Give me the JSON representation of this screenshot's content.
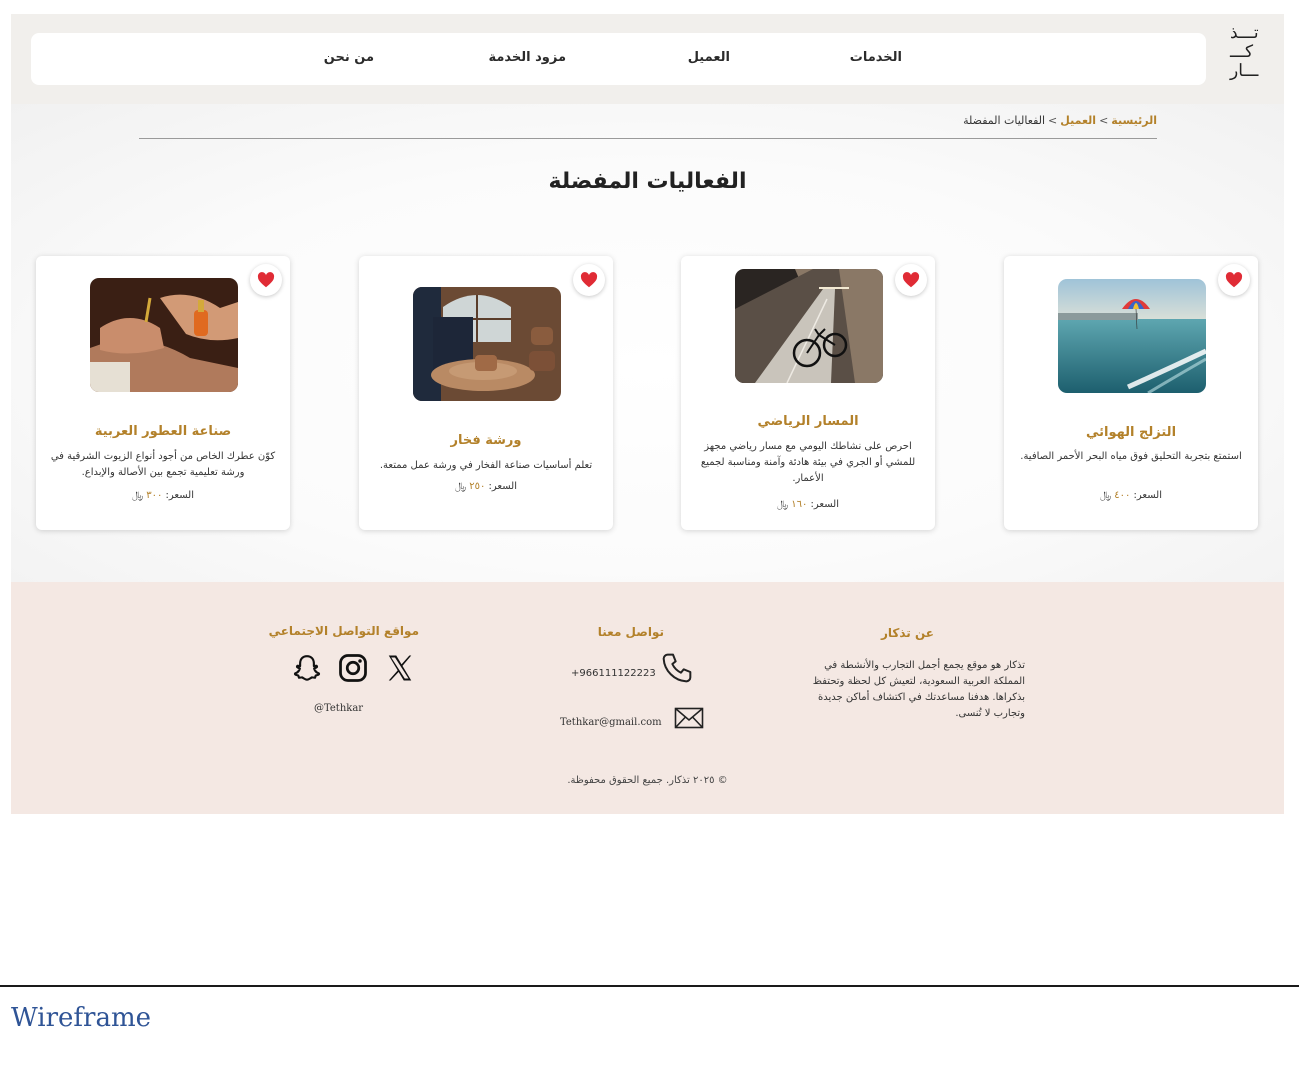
{
  "brand": {
    "logo_lines": [
      "تـــذ",
      "كـــ",
      "ـــار"
    ]
  },
  "nav": {
    "services": "الخدمات",
    "client": "العميل",
    "provider": "مزود الخدمة",
    "about": "من نحن"
  },
  "breadcrumb": {
    "home": "الرئيسية",
    "client": "العميل",
    "current": "الفعاليات المفضلة",
    "separator": ">"
  },
  "page": {
    "title": "الفعاليات المفضلة"
  },
  "cards": [
    {
      "title": "التزلج الهوائي",
      "description": "استمتع بتجربة التحليق فوق مياه البحر الأحمر الصافية.",
      "price_label": "السعر:",
      "price": "٤٠٠",
      "currency": "﷼",
      "image": "parasailing-photo",
      "favorite": true
    },
    {
      "title": "المسار الرياضي",
      "description": "احرص على نشاطك اليومي مع مسار رياضي مجهز للمشي أو الجري في بيئة هادئة وآمنة ومناسبة لجميع الأعمار.",
      "price_label": "السعر:",
      "price": "١٦٠",
      "currency": "﷼",
      "image": "bike-track-photo",
      "favorite": true
    },
    {
      "title": "ورشة فخار",
      "description": "تعلم أساسيات صناعة الفخار في ورشة عمل ممتعة.",
      "price_label": "السعر:",
      "price": "٢٥٠",
      "currency": "﷼",
      "image": "pottery-photo",
      "favorite": true
    },
    {
      "title": "صناعة العطور العربية",
      "description": "كوّن عطرك الخاص من أجود أنواع الزيوت الشرقية في ورشة تعليمية تجمع بين الأصالة والإبداع.",
      "price_label": "السعر:",
      "price": "٣٠٠",
      "currency": "﷼",
      "image": "perfume-photo",
      "favorite": true
    }
  ],
  "footer": {
    "about_title": "عن تذكار",
    "about_text": "تذكار هو موقع يجمع أجمل التجارب والأنشطة في المملكة العربية السعودية، لتعيش كل لحظة وتحتفظ بذكراها. هدفنا مساعدتك في اكتشاف أماكن جديدة وتجارب لا تُنسى.",
    "contact_title": "تواصل معنا",
    "phone": "+966111122223",
    "email": "Tethkar@gmail.com",
    "social_title": "مواقع التواصل الاجتماعي",
    "social_handle": "@Tethkar",
    "social_icons": [
      "x-icon",
      "instagram-icon",
      "snapchat-icon"
    ],
    "copyright": "© ٢٠٢٥ تذكار. جميع الحقوق محفوظة."
  },
  "doc": {
    "section_label": "Wireframe"
  },
  "colors": {
    "accent": "#b3812a",
    "heart": "#e02b35",
    "footer_bg": "#f4e8e3",
    "header_bg": "#f1efec"
  }
}
